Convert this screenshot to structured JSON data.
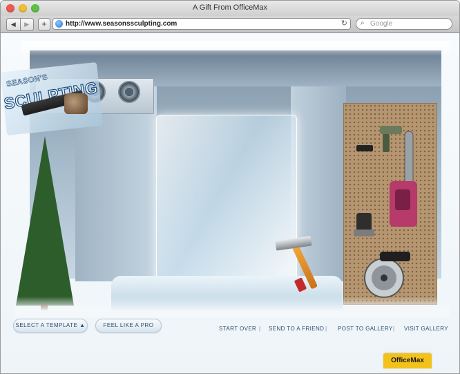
{
  "window": {
    "title": "A Gift From OfficeMax"
  },
  "toolbar": {
    "back_glyph": "◀",
    "forward_glyph": "▶",
    "add_glyph": "+",
    "url": "http://www.seasonssculpting.com",
    "reload_glyph": "↻",
    "search_placeholder": "Google",
    "search_glyph": "⌕"
  },
  "logo": {
    "line1": "SEASON'S",
    "line2": "SCULPTING"
  },
  "controls": {
    "select_template": "SELECT A TEMPLATE ▲",
    "feel_like_pro": "FEEL LIKE A PRO"
  },
  "nav": {
    "start_over": "START OVER",
    "send_to_friend": "SEND TO A FRIEND",
    "post_to_gallery": "POST TO GALLERY",
    "visit_gallery": "VISIT GALLERY",
    "separator": "|"
  },
  "brand": {
    "badge": "OfficeMax"
  },
  "colors": {
    "close": "#ee5b52",
    "minimize": "#f1be33",
    "maximize": "#5ec145",
    "link": "#2a4f74",
    "brand": "#f2c21b"
  }
}
